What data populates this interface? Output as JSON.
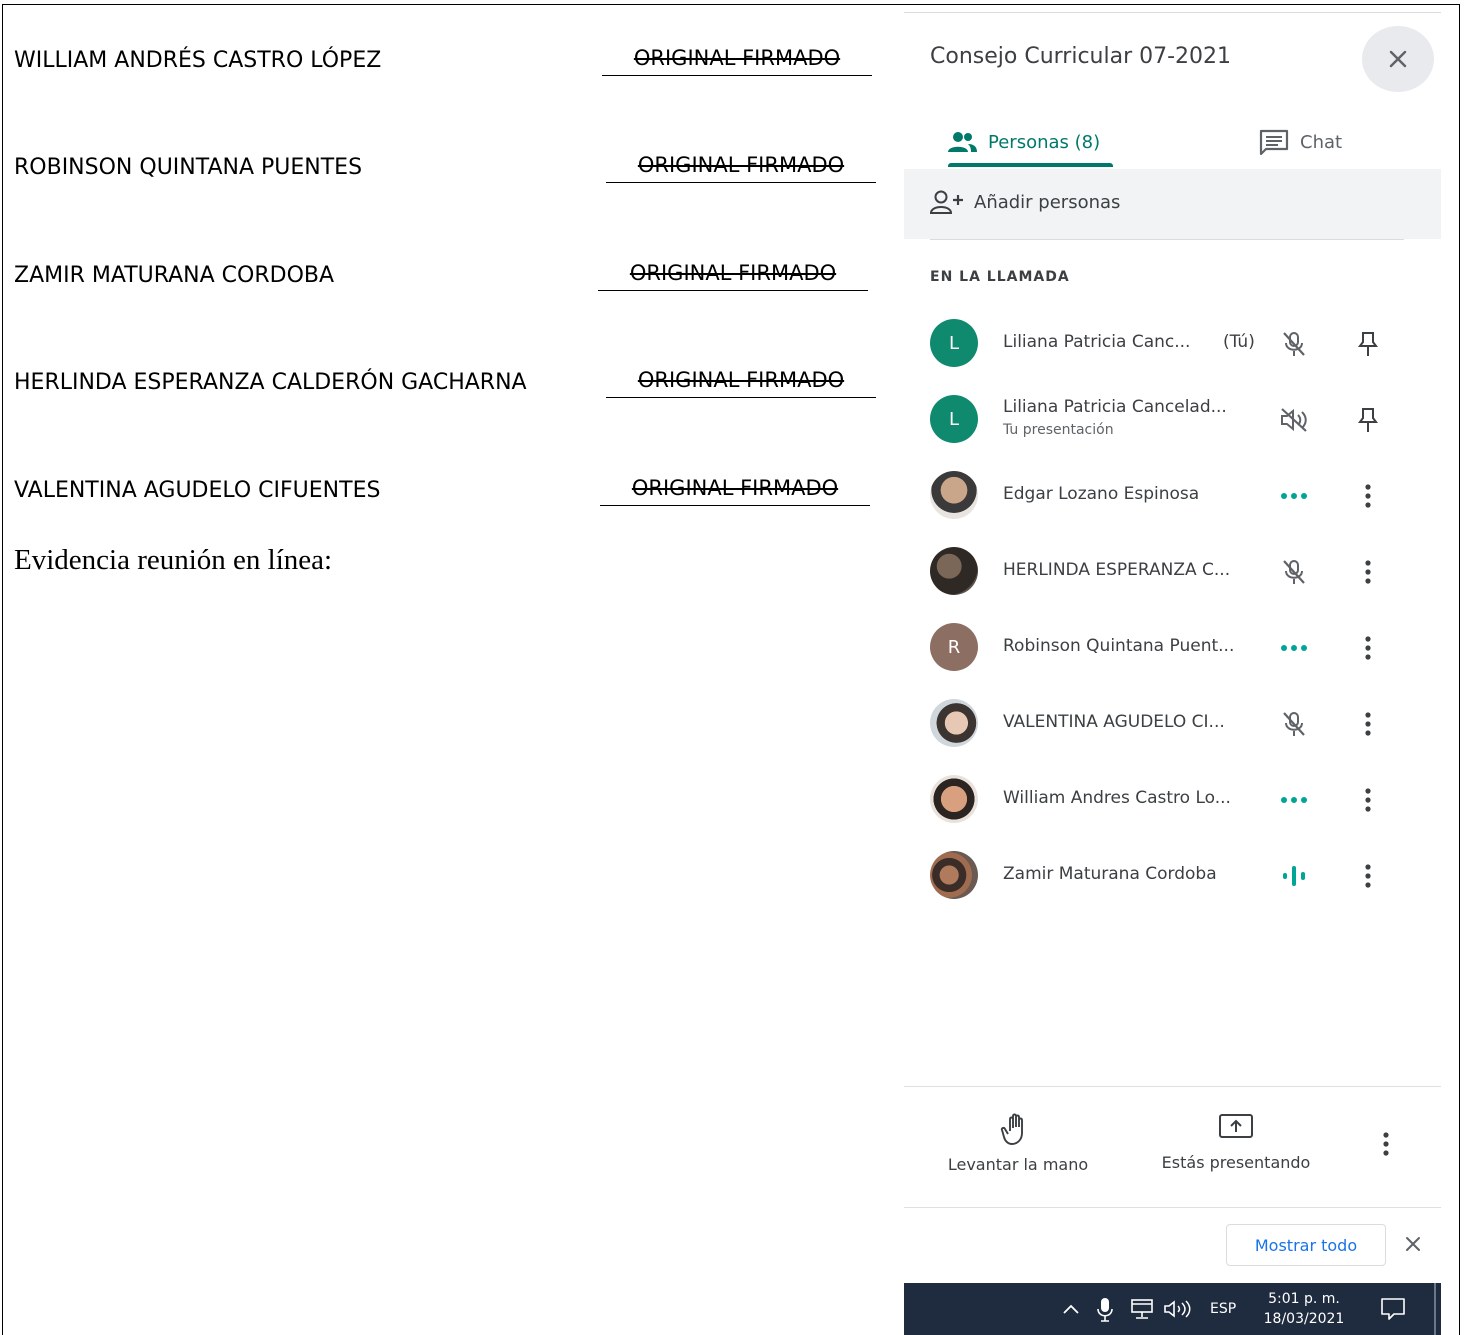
{
  "signatures": [
    {
      "name": "WILLIAM ANDRÉS CASTRO LÓPEZ",
      "signature": "ORIGINAL FIRMADO"
    },
    {
      "name": "ROBINSON QUINTANA PUENTES",
      "signature": "ORIGINAL FIRMADO"
    },
    {
      "name": "ZAMIR MATURANA CORDOBA",
      "signature": "ORIGINAL FIRMADO"
    },
    {
      "name": "HERLINDA ESPERANZA CALDERÓN GACHARNA",
      "signature": "ORIGINAL FIRMADO"
    },
    {
      "name": "VALENTINA AGUDELO CIFUENTES",
      "signature": "ORIGINAL FIRMADO"
    }
  ],
  "evidence_label": "Evidencia reunión en línea:",
  "panel": {
    "title": "Consejo Curricular 07-2021",
    "close_icon": "close-icon",
    "tabs": {
      "people": "Personas (8)",
      "chat": "Chat"
    },
    "add_people": "Añadir personas",
    "section_label": "EN LA LLAMADA",
    "participants": [
      {
        "name": "Liliana Patricia Canc...",
        "you_tag": "(Tú)",
        "initial": "L",
        "status_icon": "mic-off-icon",
        "action_icon": "pin-icon",
        "avatar_color": "#0f8a6e"
      },
      {
        "name": "Liliana Patricia Cancelad...",
        "subtitle": "Tu presentación",
        "initial": "L",
        "status_icon": "speaker-muted-icon",
        "action_icon": "pin-icon",
        "avatar_color": "#0f8a6e"
      },
      {
        "name": "Edgar Lozano Espinosa",
        "status_icon": "dots-indicator-icon",
        "action_icon": "more-vert-icon",
        "avatar_color": "#8a7058"
      },
      {
        "name": "HERLINDA ESPERANZA C...",
        "status_icon": "mic-off-icon",
        "action_icon": "more-vert-icon",
        "avatar_color": "#4a3f36"
      },
      {
        "name": "Robinson Quintana Puent...",
        "initial": "R",
        "status_icon": "dots-indicator-icon",
        "action_icon": "more-vert-icon",
        "avatar_color": "#8d6e63"
      },
      {
        "name": "VALENTINA AGUDELO CI...",
        "status_icon": "mic-off-icon",
        "action_icon": "more-vert-icon",
        "avatar_color": "#b09a8c"
      },
      {
        "name": "William Andres Castro Lo...",
        "status_icon": "dots-indicator-icon",
        "action_icon": "more-vert-icon",
        "avatar_color": "#c08a6a"
      },
      {
        "name": "Zamir Maturana Cordoba",
        "status_icon": "speaking-bars-icon",
        "action_icon": "more-vert-icon",
        "avatar_color": "#5a4a40"
      }
    ],
    "bottom": {
      "raise_hand": "Levantar la mano",
      "presenting": "Estás presentando"
    },
    "show_all": "Mostrar todo"
  },
  "taskbar": {
    "lang": "ESP",
    "time": "5:01 p. m.",
    "date": "18/03/2021"
  },
  "colors": {
    "accent": "#00796b",
    "taskbar": "#1f2b3e",
    "link": "#1a73e8"
  }
}
